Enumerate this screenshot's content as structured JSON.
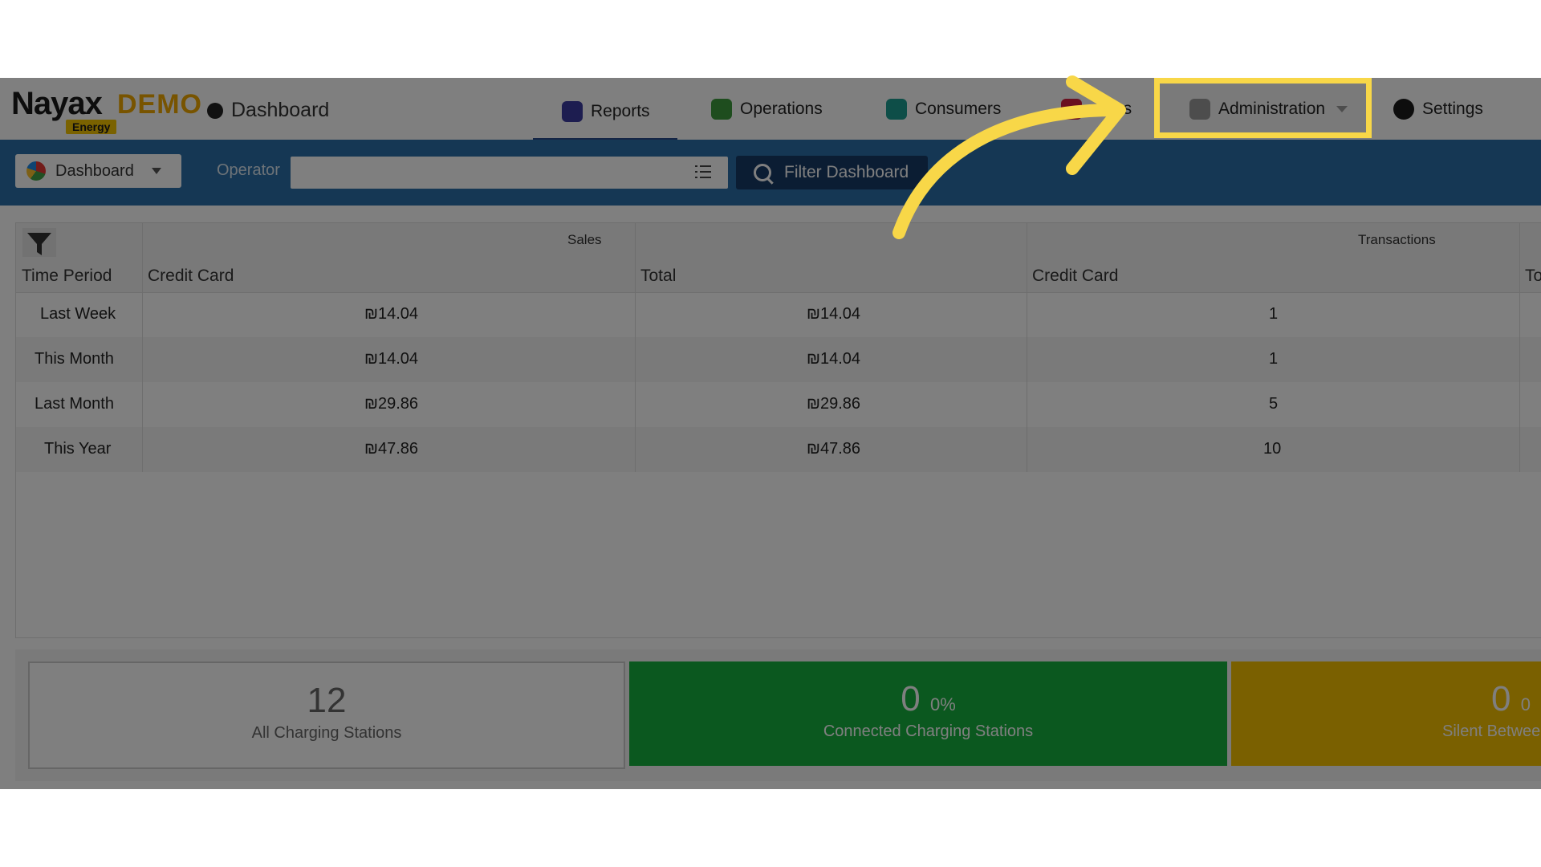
{
  "header": {
    "logo": {
      "brand": "Nayax",
      "demo": "DEMO",
      "tag": "Energy"
    },
    "breadcrumb": "Dashboard",
    "nav": [
      {
        "label": "Reports",
        "icon": "reports-icon"
      },
      {
        "label": "Operations",
        "icon": "operations-icon"
      },
      {
        "label": "Consumers",
        "icon": "consumers-icon"
      },
      {
        "label": "gs",
        "icon": "tags-icon"
      },
      {
        "label": "Administration",
        "icon": "administration-icon"
      },
      {
        "label": "Settings",
        "icon": "settings-icon"
      }
    ]
  },
  "toolbar": {
    "dashboard_select": "Dashboard",
    "operator_label": "Operator",
    "operator_value": "",
    "filter_button": "Filter Dashboard"
  },
  "table": {
    "groups": [
      "Sales",
      "Transactions"
    ],
    "headers": [
      "Time Period",
      "Credit Card",
      "Total",
      "Credit Card",
      "To"
    ],
    "rows": [
      {
        "period": "Last Week",
        "sales_cc": "₪14.04",
        "sales_total": "₪14.04",
        "tx_cc": "1"
      },
      {
        "period": "This Month",
        "sales_cc": "₪14.04",
        "sales_total": "₪14.04",
        "tx_cc": "1"
      },
      {
        "period": "Last Month",
        "sales_cc": "₪29.86",
        "sales_total": "₪29.86",
        "tx_cc": "5"
      },
      {
        "period": "This Year",
        "sales_cc": "₪47.86",
        "sales_total": "₪47.86",
        "tx_cc": "10"
      }
    ]
  },
  "cards": [
    {
      "value": "12",
      "pct": "",
      "label": "All Charging Stations"
    },
    {
      "value": "0",
      "pct": "0%",
      "label": "Connected Charging Stations"
    },
    {
      "value": "0",
      "pct": "0",
      "label": "Silent Between"
    }
  ],
  "colors": {
    "highlight": "#f8d748",
    "toolbar": "#2a6fa8",
    "connected": "#17b13f",
    "silent": "#f5c000"
  }
}
